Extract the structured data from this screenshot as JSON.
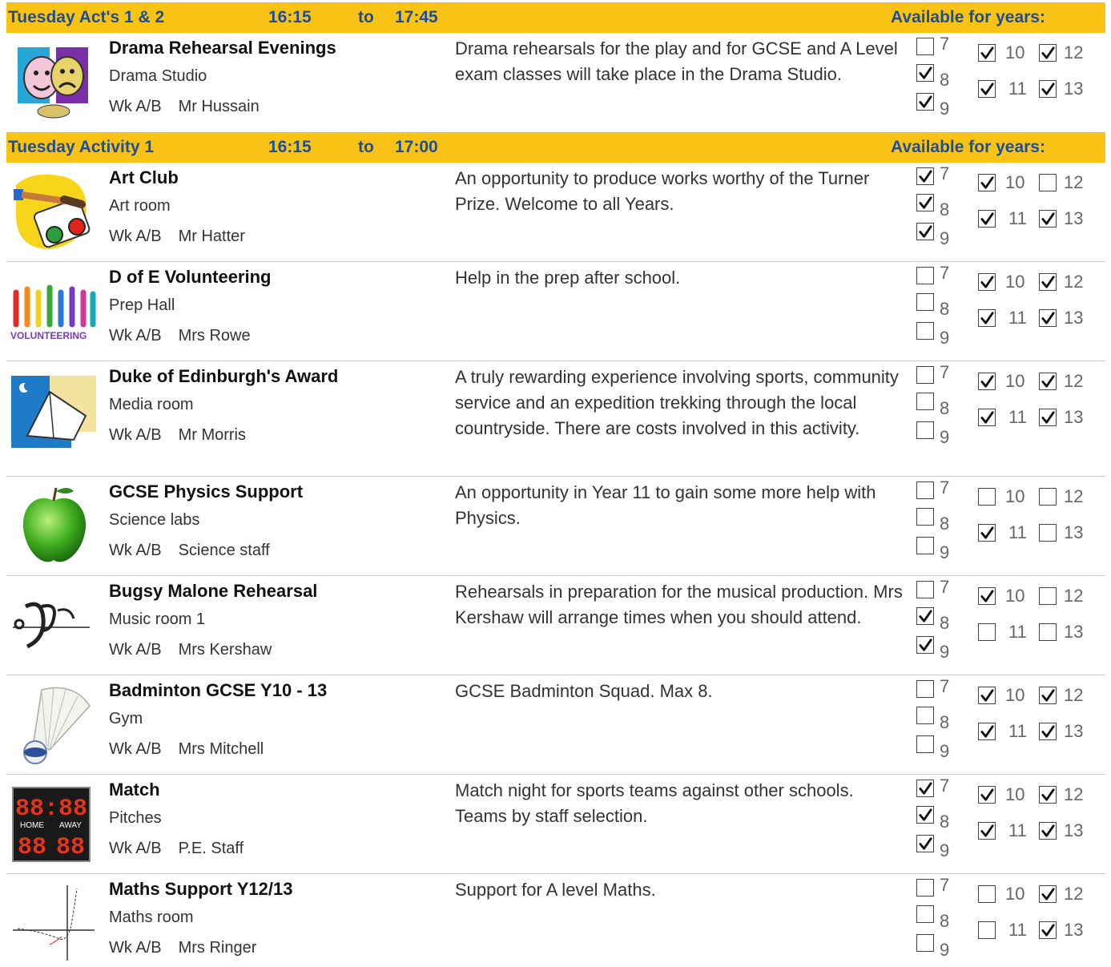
{
  "sections": [
    {
      "title": "Tuesday Act's 1 & 2",
      "start": "16:15",
      "to": "to",
      "end": "17:45",
      "available_label": "Available for years:",
      "activities": [
        {
          "name": "Drama Rehearsal Evenings",
          "room": "Drama Studio",
          "week": "Wk  A/B",
          "staff": "Mr Hussain",
          "description": "Drama rehearsals for the play and for GCSE and A Level exam classes will take place in the Drama Studio.",
          "icon": "drama-masks-icon",
          "years": {
            "7": false,
            "8": true,
            "9": true,
            "10": true,
            "11": true,
            "12": true,
            "13": true
          }
        }
      ]
    },
    {
      "title": "Tuesday Activity 1",
      "start": "16:15",
      "to": "to",
      "end": "17:00",
      "available_label": "Available for years:",
      "activities": [
        {
          "name": "Art Club",
          "room": "Art room",
          "week": "Wk  A/B",
          "staff": "Mr Hatter",
          "description": "An opportunity to produce works worthy of the Turner Prize.  Welcome to all Years.",
          "icon": "paint-palette-icon",
          "years": {
            "7": true,
            "8": true,
            "9": true,
            "10": true,
            "11": true,
            "12": false,
            "13": true
          }
        },
        {
          "name": "D of E Volunteering",
          "room": "Prep Hall",
          "week": "Wk  A/B",
          "staff": "Mrs Rowe",
          "description": "Help in the prep after school.",
          "icon": "volunteering-hands-icon",
          "icon_text": "VOLUNTEERING",
          "years": {
            "7": false,
            "8": false,
            "9": false,
            "10": true,
            "11": true,
            "12": true,
            "13": true
          }
        },
        {
          "name": "Duke of Edinburgh's Award",
          "room": "Media room",
          "week": "Wk  A/B",
          "staff": "Mr Morris",
          "description": "A truly rewarding experience involving sports, community service and an expedition trekking through the local countryside.  There are costs involved in this activity.",
          "icon": "tent-icon",
          "years": {
            "7": false,
            "8": false,
            "9": false,
            "10": true,
            "11": true,
            "12": true,
            "13": true
          }
        },
        {
          "name": "GCSE Physics  Support",
          "room": "Science labs",
          "week": "Wk  A/B",
          "staff": "Science staff",
          "description": "An opportunity in Year 11  to gain some more help with Physics.",
          "icon": "green-apple-icon",
          "years": {
            "7": false,
            "8": false,
            "9": false,
            "10": false,
            "11": true,
            "12": false,
            "13": false
          }
        },
        {
          "name": "Bugsy Malone Rehearsal",
          "room": "Music room 1",
          "week": "Wk  A/B",
          "staff": "Mrs Kershaw",
          "description": "Rehearsals in preparation for the musical production.  Mrs Kershaw will arrange times when you should attend.",
          "icon": "bugsy-logo-icon",
          "years": {
            "7": false,
            "8": true,
            "9": true,
            "10": true,
            "11": false,
            "12": false,
            "13": false
          }
        },
        {
          "name": "Badminton GCSE Y10 - 13",
          "room": "Gym",
          "week": "Wk  A/B",
          "staff": "Mrs Mitchell",
          "description": "GCSE Badminton Squad.  Max 8.",
          "icon": "shuttlecock-icon",
          "years": {
            "7": false,
            "8": false,
            "9": false,
            "10": true,
            "11": true,
            "12": true,
            "13": true
          }
        },
        {
          "name": "Match",
          "room": "Pitches",
          "week": "Wk  A/B",
          "staff": "P.E. Staff",
          "description": "Match night for sports teams against other schools.  Teams by staff selection.",
          "icon": "scoreboard-icon",
          "icon_text": {
            "top": "88:88",
            "home": "HOME",
            "away": "AWAY",
            "bottom_left": "88",
            "bottom_right": "88"
          },
          "years": {
            "7": true,
            "8": true,
            "9": true,
            "10": true,
            "11": true,
            "12": true,
            "13": true
          }
        },
        {
          "name": "Maths Support Y12/13",
          "room": "Maths room",
          "week": "Wk  A/B",
          "staff": "Mrs Ringer",
          "description": "Support for A level Maths.",
          "icon": "graph-axes-icon",
          "years": {
            "7": false,
            "8": false,
            "9": false,
            "10": false,
            "11": false,
            "12": true,
            "13": true
          }
        }
      ]
    }
  ],
  "colors": {
    "header_bg": "#f9c316",
    "header_text": "#1f4e96"
  }
}
